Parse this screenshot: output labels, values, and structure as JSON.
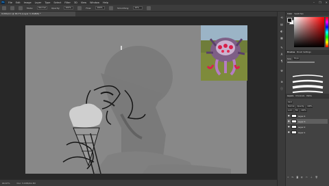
{
  "menubar": {
    "logo": "Ps",
    "items": [
      "File",
      "Edit",
      "Image",
      "Layer",
      "Type",
      "Select",
      "Filter",
      "3D",
      "View",
      "Window",
      "Help"
    ],
    "window_controls": [
      "–",
      "❐",
      "✕"
    ]
  },
  "options": {
    "mode_label": "Mode:",
    "mode_value": "Normal",
    "opacity_label": "Opacity:",
    "opacity_value": "100%",
    "flow_label": "Flow:",
    "flow_value": "100%",
    "smoothing_label": "Smoothing:",
    "smoothing_value": "10%"
  },
  "document": {
    "tab_label": "Untitled-1 @ 66.7% (Layer 3, RGB/8) *"
  },
  "status": {
    "zoom": "66.67%",
    "doc_info": "Doc: 5.93M/24.3M"
  },
  "panels": {
    "color_tabs": [
      "Color",
      "Swatches"
    ],
    "brush_tabs": [
      "Brushes",
      "Brush Settings"
    ],
    "brush_size_label": "Size:",
    "brush_size_value": "70 px",
    "layers_tabs": [
      "Layers",
      "Channels",
      "Paths"
    ],
    "kind_label": "Kind",
    "blend_value": "Normal",
    "opacity_label": "Opacity:",
    "opacity_value": "100%",
    "lock_label": "Lock:",
    "fill_label": "Fill:",
    "fill_value": "100%",
    "layers": [
      {
        "name": "Layer 4",
        "visible": true,
        "active": false
      },
      {
        "name": "Layer 3",
        "visible": true,
        "active": true
      },
      {
        "name": "Layer 2",
        "visible": true,
        "active": false
      },
      {
        "name": "Layer 1",
        "visible": true,
        "active": false
      }
    ],
    "footer_icons": [
      "link-icon",
      "fx-icon",
      "mask-icon",
      "adjustment-icon",
      "folder-icon",
      "new-layer-icon",
      "trash-icon"
    ]
  },
  "colors": {
    "foreground": "#0e0e0e",
    "background": "#ffffff",
    "canvas_fill": "#888888"
  }
}
